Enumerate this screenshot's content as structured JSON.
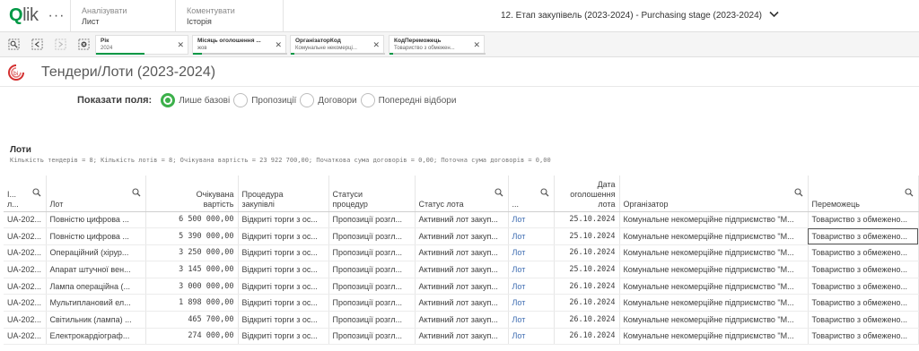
{
  "topbar": {
    "logo_q": "Q",
    "logo_rest": "lik",
    "more": "···",
    "analyze_sub": "Аналізувати",
    "analyze_main": "Лист",
    "comment_sub": "Коментувати",
    "comment_main": "Історія",
    "app_title": "12. Етап закупівель (2023-2024) - Purchasing stage (2023-2024)"
  },
  "selections": [
    {
      "title": "Рік",
      "value": "2024"
    },
    {
      "title": "Місяць оголошення ...",
      "value": "жов"
    },
    {
      "title": "ОрганізаторКод",
      "value": "Комунальне некомерці..."
    },
    {
      "title": "КодПереможець",
      "value": "Товариство з обмежен..."
    }
  ],
  "sheet": {
    "title": "Тендери/Лоти (2023-2024)"
  },
  "fields": {
    "label": "Показати поля:",
    "options": [
      "Лише базові",
      "Пропозиції",
      "Договори",
      "Попередні відбори"
    ],
    "selected": "Лише базові"
  },
  "table": {
    "title": "Лоти",
    "subtitle": "Кількість тендерів = 8; Кількість лотів = 8; Очікувана вартість = 23 922 700,00; Початкова сума договорів = 0,00; Поточна сума договорів = 0,00",
    "headers": {
      "c1a": "І...",
      "c1b": "л...",
      "c2": "Лот",
      "c3a": "Очікувана",
      "c3b": "вартість",
      "c4a": "Процедура",
      "c4b": "закупівлі",
      "c5a": "Статуси",
      "c5b": "процедур",
      "c6": "Статус лота",
      "c7": "...",
      "c8a": "Дата",
      "c8b": "оголошення",
      "c8c": "лота",
      "c9": "Організатор",
      "c10": "Переможець"
    },
    "rows": [
      [
        "UA-202...",
        "Повністю цифрова ...",
        "6 500 000,00",
        "Відкриті торги з ос...",
        "Пропозиції розгл...",
        "Активний лот закуп...",
        "Лот",
        "25.10.2024",
        "Комунальне некомерційне підприємство \"М...",
        "Товариство з обмежено..."
      ],
      [
        "UA-202...",
        "Повністю цифрова ...",
        "5 390 000,00",
        "Відкриті торги з ос...",
        "Пропозиції розгл...",
        "Активний лот закуп...",
        "Лот",
        "25.10.2024",
        "Комунальне некомерційне підприємство \"М...",
        "Товариство з обмежено..."
      ],
      [
        "UA-202...",
        "Операційний (хірур...",
        "3 250 000,00",
        "Відкриті торги з ос...",
        "Пропозиції розгл...",
        "Активний лот закуп...",
        "Лот",
        "26.10.2024",
        "Комунальне некомерційне підприємство \"М...",
        "Товариство з обмежено..."
      ],
      [
        "UA-202...",
        "Апарат штучної вен...",
        "3 145 000,00",
        "Відкриті торги з ос...",
        "Пропозиції розгл...",
        "Активний лот закуп...",
        "Лот",
        "25.10.2024",
        "Комунальне некомерційне підприємство \"М...",
        "Товариство з обмежено..."
      ],
      [
        "UA-202...",
        "Лампа операційна (...",
        "3 000 000,00",
        "Відкриті торги з ос...",
        "Пропозиції розгл...",
        "Активний лот закуп...",
        "Лот",
        "26.10.2024",
        "Комунальне некомерційне підприємство \"М...",
        "Товариство з обмежено..."
      ],
      [
        "UA-202...",
        "Мультиплановий ел...",
        "1 898 000,00",
        "Відкриті торги з ос...",
        "Пропозиції розгл...",
        "Активний лот закуп...",
        "Лот",
        "26.10.2024",
        "Комунальне некомерційне підприємство \"М...",
        "Товариство з обмежено..."
      ],
      [
        "UA-202...",
        "Світильник (лампа) ...",
        "465 700,00",
        "Відкриті торги з ос...",
        "Пропозиції розгл...",
        "Активний лот закуп...",
        "Лот",
        "26.10.2024",
        "Комунальне некомерційне підприємство \"М...",
        "Товариство з обмежено..."
      ],
      [
        "UA-202...",
        "Електрокардіограф...",
        "274 000,00",
        "Відкриті торги з ос...",
        "Пропозиції розгл...",
        "Активний лот закуп...",
        "Лот",
        "26.10.2024",
        "Комунальне некомерційне підприємство \"М...",
        "Товариство з обмежено..."
      ]
    ]
  },
  "colors": {
    "accent": "#009845",
    "radio_on": "#3cb04a",
    "link": "#3f6db2"
  }
}
